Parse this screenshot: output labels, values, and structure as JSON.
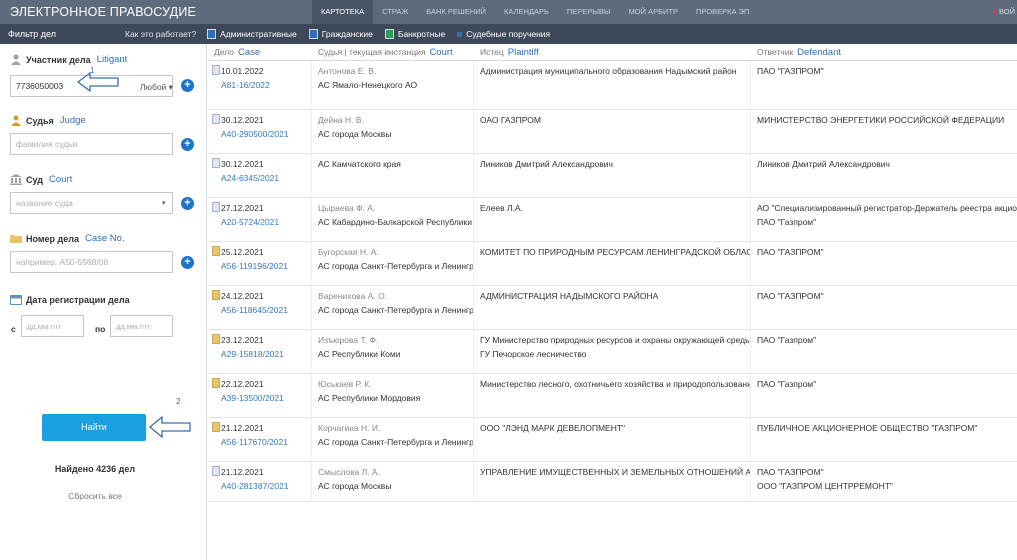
{
  "topbar": {
    "brand": "ЭЛЕКТРОННОЕ ПРАВОСУДИЕ",
    "nav": [
      "КАРТОТЕКА",
      "СТРАЖ",
      "БАНК РЕШЕНИЙ",
      "КАЛЕНДАРЬ",
      "ПЕРЕРЫВЫ",
      "МОЙ АРБИТР",
      "ПРОВЕРКА ЭП"
    ],
    "login": "ВОЙ"
  },
  "filterbar": {
    "title": "Фильтр дел",
    "howto": "Как это работает?",
    "chips": [
      "Административные",
      "Гражданские",
      "Банкротные",
      "Судебные поручения"
    ]
  },
  "left": {
    "participant": {
      "label": "Участник дела",
      "en": "Litigant",
      "value": "7736050003",
      "any": "Любой ▾"
    },
    "judge": {
      "label": "Судья",
      "en": "Judge",
      "placeholder": "фамилия судьи"
    },
    "court": {
      "label": "Суд",
      "en": "Court",
      "placeholder": "название суда"
    },
    "caseno": {
      "label": "Номер дела",
      "en": "Case No.",
      "placeholder": "например, А50-5568/08"
    },
    "date": {
      "label": "Дата регистрации дела",
      "from": "с",
      "to": "по",
      "placeholder": "дд.мм.гггг"
    },
    "search_button": "Найти",
    "found": "Найдено 4236 дел",
    "reset": "Сбросить все",
    "annotations": [
      "1",
      "2"
    ]
  },
  "table": {
    "headers": [
      {
        "ru": "Дело",
        "en": "Case"
      },
      {
        "ru": "Судья | текущая инстанция",
        "en": "Court"
      },
      {
        "ru": "Истец",
        "en": "Plaintiff"
      },
      {
        "ru": "Ответчик",
        "en": "Defendant"
      }
    ],
    "rows": [
      {
        "date": "10.01.2022",
        "case": "А81-16/2022",
        "judge": "Антонова Е. В.",
        "court": "АС Ямало-Ненецкого АО",
        "plaintiff": [
          "Администрация муниципального образования Надымский район"
        ],
        "defendant": [
          "ПАО \"ГАЗПРОМ\""
        ],
        "icon": "s"
      },
      {
        "date": "30.12.2021",
        "case": "А40-290500/2021",
        "judge": "Дейна Н. В.",
        "court": "АС города Москвы",
        "plaintiff": [
          "ОАО ГАЗПРОМ"
        ],
        "defendant": [
          "МИНИСТЕРСТВО ЭНЕРГЕТИКИ РОССИЙСКОЙ ФЕДЕРАЦИИ"
        ],
        "icon": "s"
      },
      {
        "date": "30.12.2021",
        "case": "А24-6345/2021",
        "judge": "",
        "court": "АС Камчатского края",
        "plaintiff": [
          "Лиников Дмитрий Александрович"
        ],
        "defendant": [
          "Лиников Дмитрий Александрович"
        ],
        "icon": "s"
      },
      {
        "date": "27.12.2021",
        "case": "А20-5724/2021",
        "judge": "Цыраева Ф. А.",
        "court": "АС Кабардино-Балкарской Республики",
        "plaintiff": [
          "Елеев Л.А."
        ],
        "defendant": [
          "АО \"Специализированный регистратор-Держатель реестра акционер",
          "ПАО \"Газпром\""
        ],
        "icon": "s"
      },
      {
        "date": "25.12.2021",
        "case": "А56-119196/2021",
        "judge": "Бугорская Н. А.",
        "court": "АС города Санкт-Петербурга и Ленингра",
        "plaintiff": [
          "КОМИТЕТ ПО ПРИРОДНЫМ РЕСУРСАМ ЛЕНИНГРАДСКОЙ ОБЛАС"
        ],
        "defendant": [
          "ПАО \"ГАЗПРОМ\""
        ],
        "icon": "y"
      },
      {
        "date": "24.12.2021",
        "case": "А56-118645/2021",
        "judge": "Варенихова А. О.",
        "court": "АС города Санкт-Петербурга и Ленингра",
        "plaintiff": [
          "АДМИНИСТРАЦИЯ НАДЫМСКОГО РАЙОНА"
        ],
        "defendant": [
          "ПАО \"ГАЗПРОМ\""
        ],
        "icon": "y"
      },
      {
        "date": "23.12.2021",
        "case": "А29-15818/2021",
        "judge": "Изъюрова Т. Ф.",
        "court": "АС Республики Коми",
        "plaintiff": [
          "ГУ Министерство природных ресурсов и охраны окружающей среды",
          "ГУ Печорское лесничество"
        ],
        "defendant": [
          "ПАО \"Газпром\""
        ],
        "icon": "y"
      },
      {
        "date": "22.12.2021",
        "case": "А39-13500/2021",
        "judge": "Юськаев Р. К.",
        "court": "АС Республики Мордовия",
        "plaintiff": [
          "Министерство лесного, охотничьего хозяйства и природопользовани"
        ],
        "defendant": [
          "ПАО \"Газпром\""
        ],
        "icon": "y"
      },
      {
        "date": "21.12.2021",
        "case": "А56-117670/2021",
        "judge": "Корчагина Н. И.",
        "court": "АС города Санкт-Петербурга и Ленингра",
        "plaintiff": [
          "ООО \"ЛЭНД МАРК ДЕВЕЛОПМЕНТ\""
        ],
        "defendant": [
          "ПУБЛИЧНОЕ АКЦИОНЕРНОЕ ОБЩЕСТВО \"ГАЗПРОМ\""
        ],
        "icon": "y"
      },
      {
        "date": "21.12.2021",
        "case": "А40-281387/2021",
        "judge": "Смыслова Л. А.",
        "court": "АС города Москвы",
        "plaintiff": [
          "УПРАВЛЕНИЕ ИМУЩЕСТВЕННЫХ И ЗЕМЕЛЬНЫХ ОТНОШЕНИЙ А("
        ],
        "defendant": [
          "ПАО \"ГАЗПРОМ\"",
          "ООО \"ГАЗПРОМ ЦЕНТРРЕМОНТ\""
        ],
        "icon": "s"
      }
    ]
  }
}
